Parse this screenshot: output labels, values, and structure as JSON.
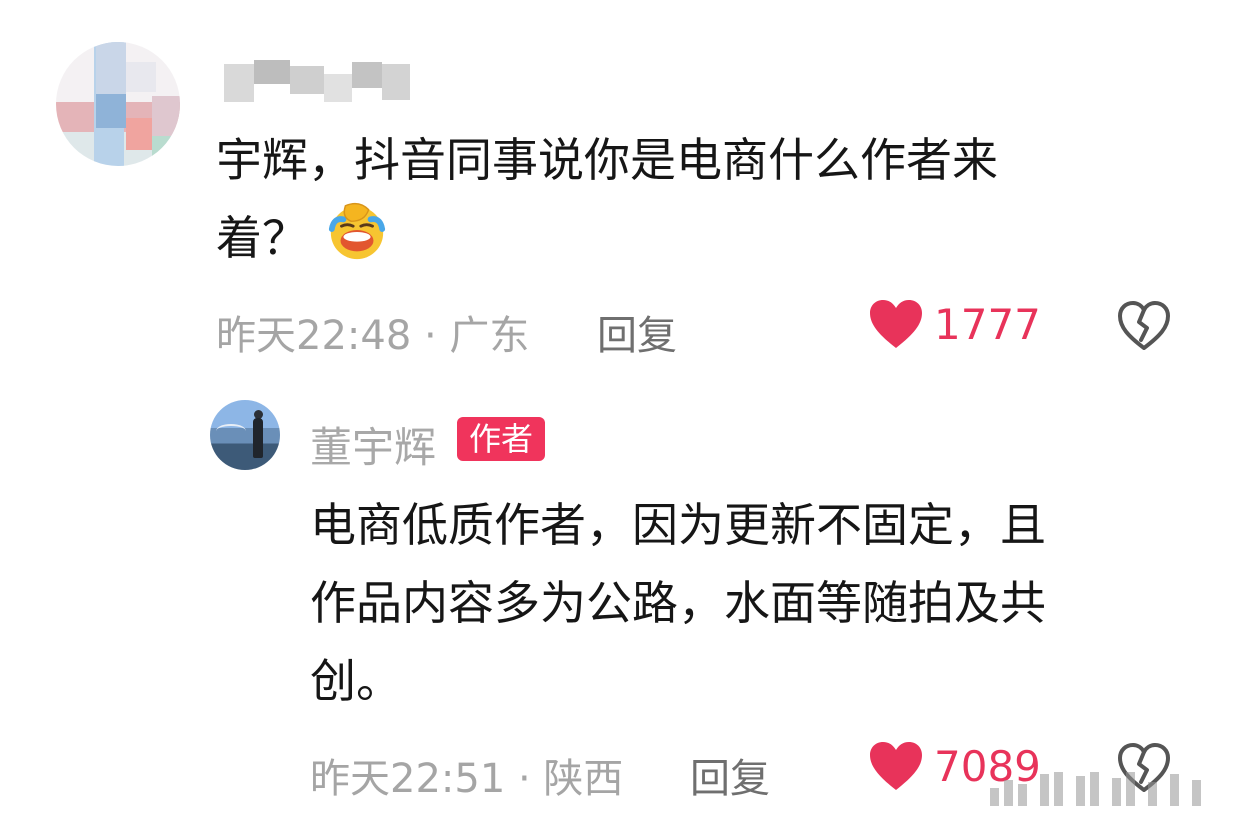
{
  "comment": {
    "avatar_icon": "user-avatar-pixelated",
    "text_line1": "宇辉，抖音同事说你是电商什么作者来",
    "text_line2": "着？",
    "emoji": "laughing-crying-emoji",
    "time_location": "昨天22:48 · 广东",
    "reply_label": "回复",
    "like_count": "1777"
  },
  "reply": {
    "avatar_icon": "author-avatar-photo",
    "name": "董宇辉",
    "badge": "作者",
    "text_line1": "电商低质作者，因为更新不固定，且",
    "text_line2": "作品内容多为公路，水面等随拍及共",
    "text_line3": "创。",
    "time_location": "昨天22:51 · 陕西",
    "reply_label": "回复",
    "like_count": "7089"
  },
  "colors": {
    "like_red": "#e8335a",
    "badge_red": "#f0345c",
    "meta_gray": "#a5a5a5"
  }
}
